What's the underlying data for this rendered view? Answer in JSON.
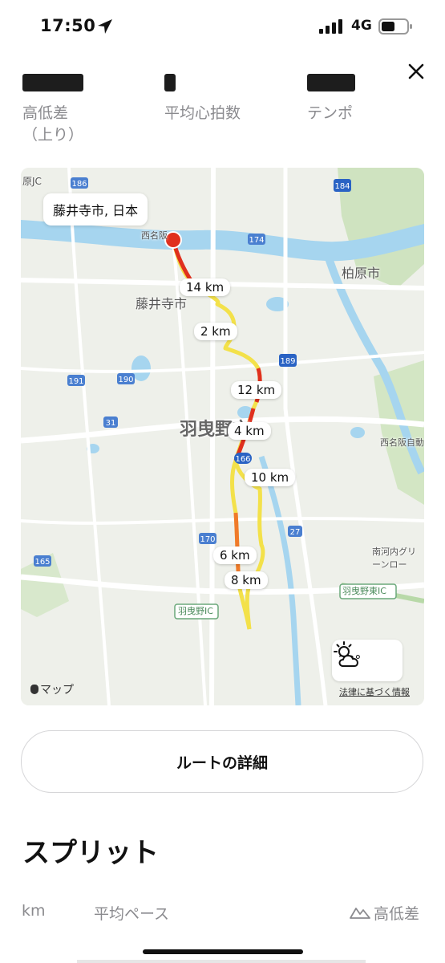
{
  "status_bar": {
    "time": "17:50",
    "network": "4G"
  },
  "stats": {
    "items": [
      {
        "label": "高低差\n（上り）"
      },
      {
        "label": "平均心拍数"
      },
      {
        "label": "テンポ"
      }
    ]
  },
  "map": {
    "location_callout": "藤井寺市, 日本",
    "places": {
      "fujiidera": "藤井寺市",
      "habikino": "羽曳野市",
      "kashiwara": "柏原市",
      "nishi_meihan": "西名阪自動",
      "nishi_meihan_top": "西名阪",
      "minami_kawachi": "南河内グリーンロー",
      "habikino_ic": "羽曳野IC",
      "habikino_higashi_ic": "羽曳野東IC",
      "ohara_jc": "原JC"
    },
    "road_numbers": [
      "186",
      "184",
      "174",
      "189",
      "191",
      "190",
      "31",
      "166",
      "170",
      "27",
      "165"
    ],
    "km_markers": [
      "14 km",
      "2 km",
      "12 km",
      "4 km",
      "10 km",
      "6 km",
      "8 km"
    ],
    "weather": {
      "temp": "23°",
      "icon": "partly-cloudy-icon"
    },
    "legal": "法律に基づく情報",
    "brand": "マップ"
  },
  "route_button": "ルートの詳細",
  "splits": {
    "title": "スプリット",
    "headers": {
      "km": "km",
      "pace": "平均ペース",
      "elevation": "高低差"
    }
  },
  "colors": {
    "route_yellow": "#f3e14a",
    "route_orange": "#f07a2a",
    "route_red": "#e0301e",
    "water": "#a6d5ef",
    "map_bg": "#eef0ea"
  }
}
